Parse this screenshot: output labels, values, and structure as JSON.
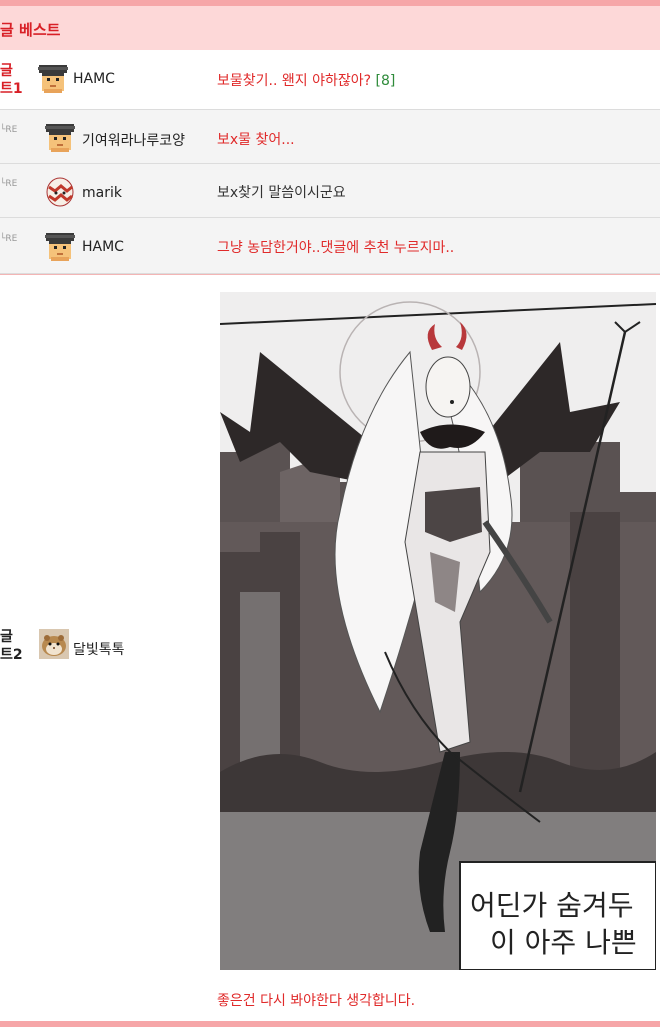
{
  "header": {
    "title": "글 베스트"
  },
  "rows": [
    {
      "rank_line1": "글",
      "rank_line2": "트1",
      "nickname": "HAMC",
      "comment": "보물찾기.. 왠지 야하잖아?",
      "count": "[8]"
    },
    {
      "re": "└RE",
      "nickname": "기여워라나루코양",
      "comment": "보x물 찾어..."
    },
    {
      "re": "└RE",
      "nickname": "marik",
      "comment": "보x찾기 말씀이시군요"
    },
    {
      "re": "└RE",
      "nickname": "HAMC",
      "comment": "그냥 농담한거야..댓글에 추천 누르지마.."
    }
  ],
  "best2": {
    "rank_line1": "글",
    "rank_line2": "트2",
    "nickname": "달빛톡톡",
    "image_caption_line1": "어딘가 숨겨두",
    "image_caption_line2": "이 아주 나쁜",
    "comment": "좋은건 다시 봐야한다 생각합니다."
  },
  "colors": {
    "accent": "#d81f26",
    "header_bg": "#fdd8d8",
    "border": "#f6a6a8",
    "count": "#2e8b3a"
  },
  "icons": [
    "pixel-avatar-icon",
    "egg-avatar-icon",
    "hamster-avatar-icon",
    "reply-arrow-icon"
  ]
}
